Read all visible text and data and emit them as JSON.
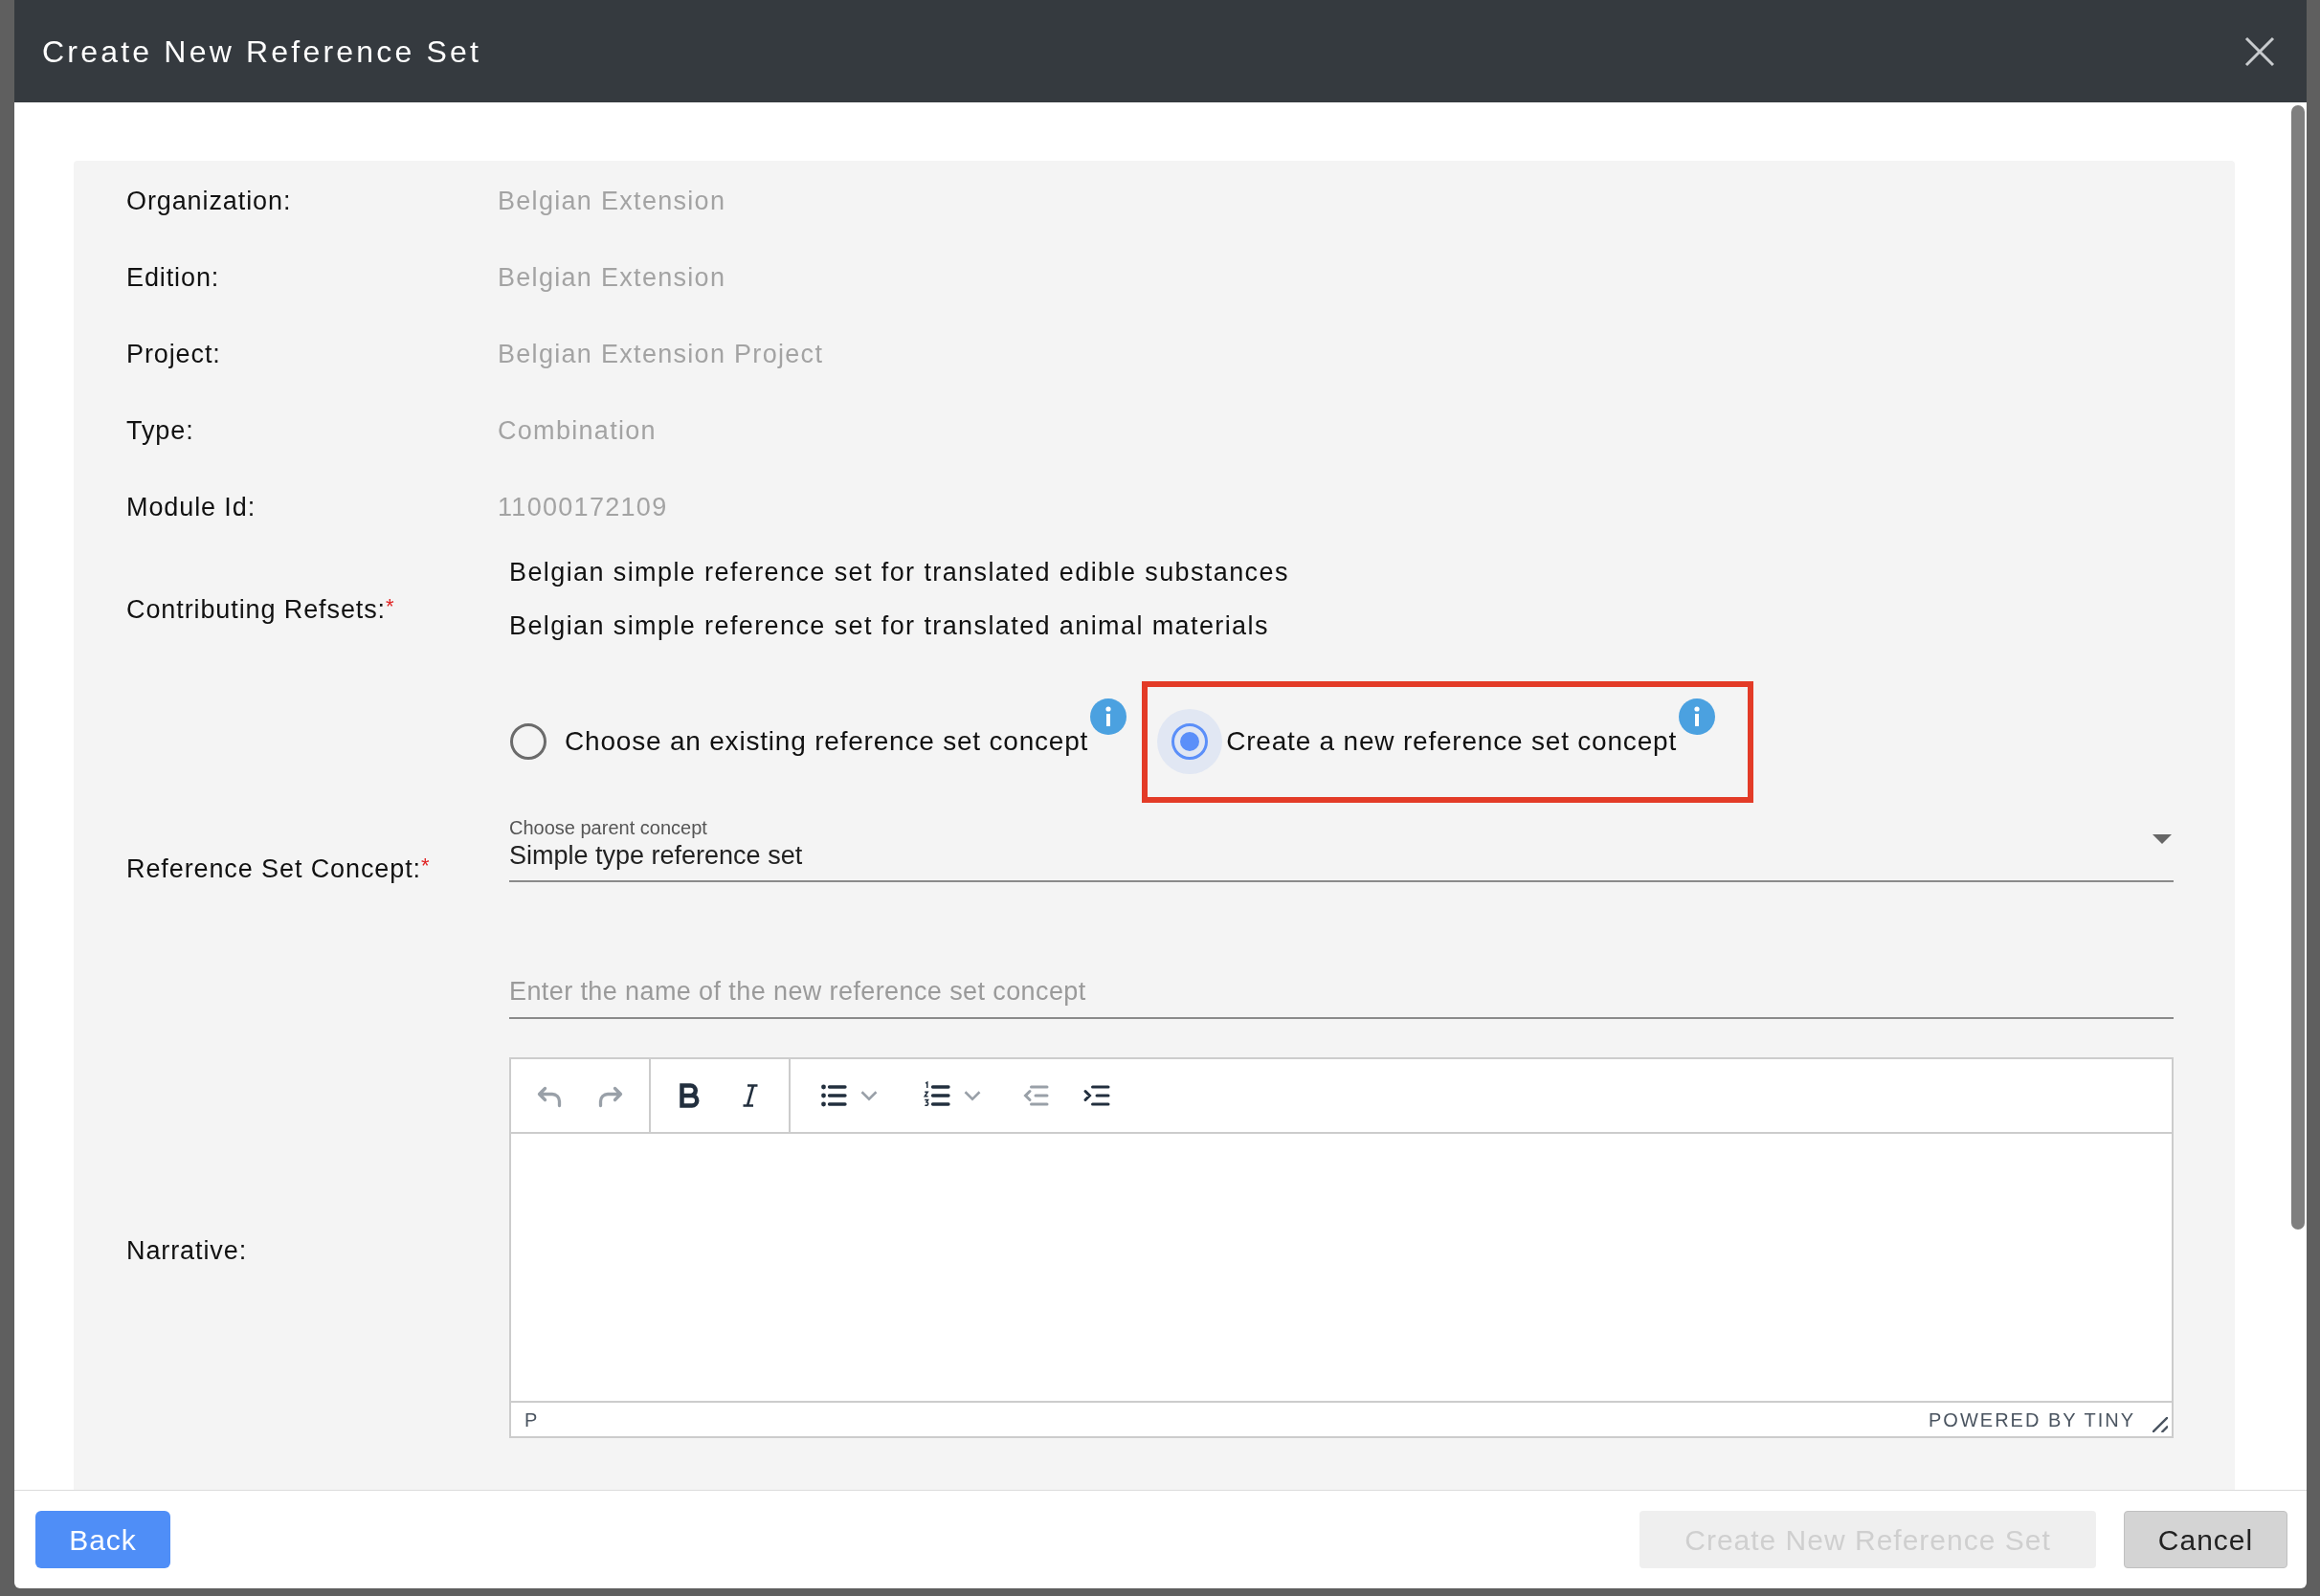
{
  "dialog": {
    "title": "Create New Reference Set"
  },
  "fields": [
    {
      "label": "Organization:",
      "value": "Belgian Extension"
    },
    {
      "label": "Edition:",
      "value": "Belgian Extension"
    },
    {
      "label": "Project:",
      "value": "Belgian Extension Project"
    },
    {
      "label": "Type:",
      "value": "Combination"
    },
    {
      "label": "Module Id:",
      "value": "11000172109"
    }
  ],
  "contributing_refsets": {
    "label": "Contributing Refsets:",
    "required_mark": "*",
    "items": [
      "Belgian simple reference set for translated edible substances",
      "Belgian simple reference set for translated animal materials"
    ]
  },
  "concept_mode": {
    "options": [
      {
        "label": "Choose an existing reference set concept",
        "selected": false,
        "highlighted": false
      },
      {
        "label": "Create a new reference set concept",
        "selected": true,
        "highlighted": true
      }
    ]
  },
  "reference_set_concept": {
    "label": "Reference Set Concept:",
    "required_mark": "*",
    "dropdown": {
      "floating_label": "Choose parent concept",
      "value": "Simple type reference set"
    },
    "name_input": {
      "placeholder": "Enter the name of the new reference set concept"
    }
  },
  "narrative": {
    "label": "Narrative:",
    "editor": {
      "toolbar": [
        [
          {
            "kind": "undo",
            "disabled": true
          },
          {
            "kind": "redo",
            "disabled": true
          }
        ],
        [
          {
            "kind": "bold",
            "disabled": false
          },
          {
            "kind": "italic",
            "disabled": false
          }
        ],
        [
          {
            "kind": "bullet-list",
            "disabled": false
          },
          {
            "kind": "numbered-list",
            "disabled": false
          },
          {
            "kind": "outdent",
            "disabled": true
          },
          {
            "kind": "indent",
            "disabled": false
          }
        ]
      ],
      "path": "P",
      "branding": "POWERED BY TINY"
    }
  },
  "footer": {
    "back": {
      "label": "Back"
    },
    "create": {
      "label": "Create New Reference Set",
      "disabled": true
    },
    "cancel": {
      "label": "Cancel"
    }
  }
}
